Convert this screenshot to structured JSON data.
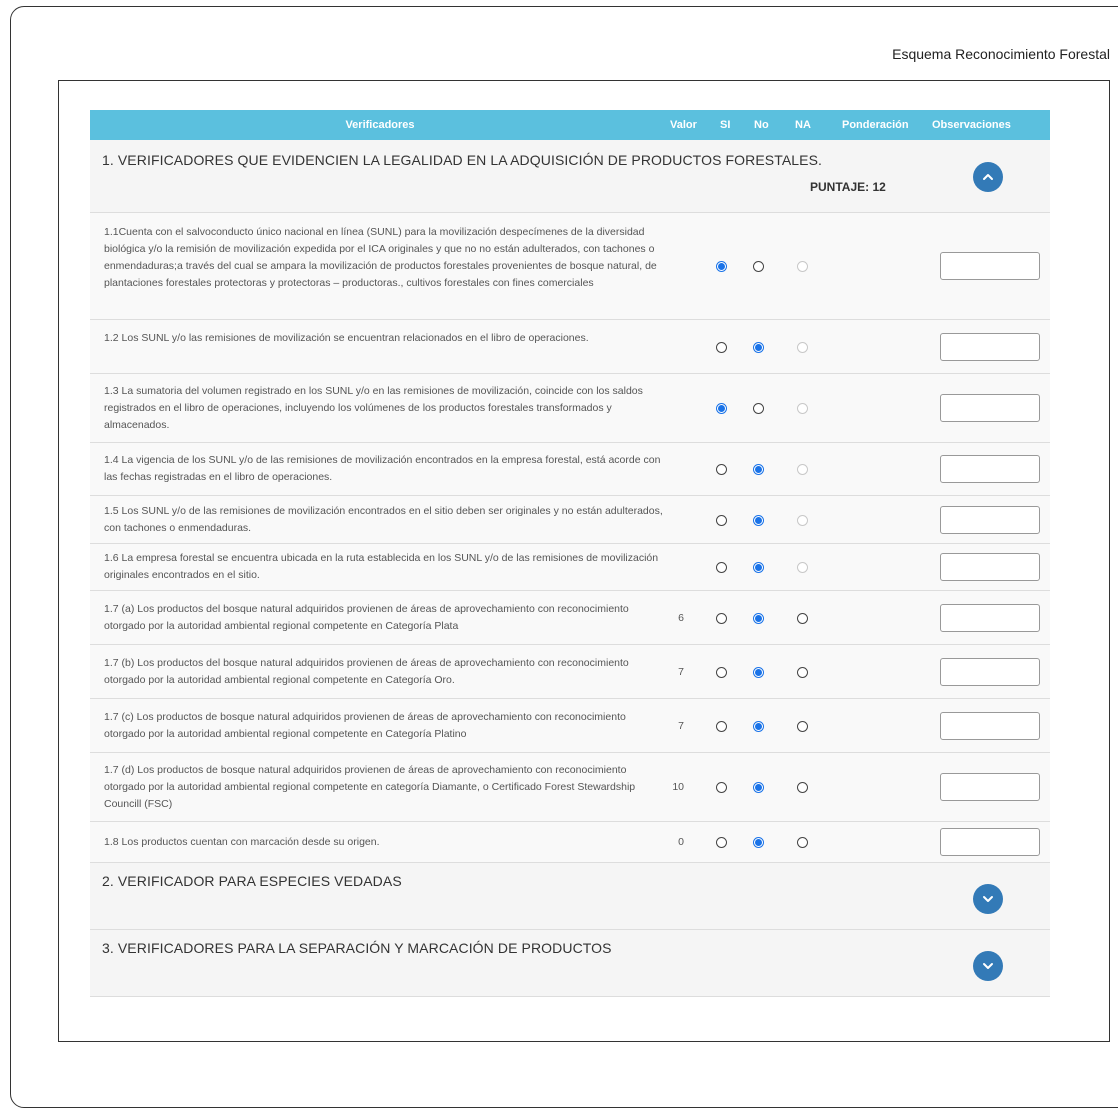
{
  "page": {
    "heading": "Esquema Reconocimiento Forestal"
  },
  "table": {
    "headers": {
      "verificadores": "Verificadores",
      "valor": "Valor",
      "si": "SI",
      "no": "No",
      "na": "NA",
      "ponderacion": "Ponderación",
      "observaciones": "Observaciones"
    }
  },
  "section1": {
    "title": "1. VERIFICADORES QUE EVIDENCIEN LA LEGALIDAD EN LA ADQUISICIÓN DE PRODUCTOS FORESTALES.",
    "score": "PUNTAJE: 12",
    "toggle_icon": "chevron-up-icon",
    "rows": [
      {
        "text": "1.1Cuenta con el salvoconducto único nacional en línea (SUNL) para la movilización despecímenes de la diversidad biológica y/o la remisión de movilización expedida por el ICA originales y que no no están adulterados, con tachones o enmendaduras;a través del cual se ampara la movilización de productos forestales provenientes de bosque natural, de plantaciones forestales protectoras y protectoras – productoras., cultivos forestales con fines comerciales",
        "valor": "",
        "selected": "si",
        "na_enabled": false,
        "observaciones": ""
      },
      {
        "text": "1.2 Los SUNL y/o las remisiones de movilización se encuentran relacionados en el libro de operaciones.",
        "valor": "",
        "selected": "no",
        "na_enabled": false,
        "observaciones": ""
      },
      {
        "text": "1.3 La sumatoria del volumen registrado en los SUNL y/o en las remisiones de movilización, coincide con los saldos registrados en el libro de operaciones, incluyendo los volúmenes de los productos forestales transformados y almacenados.",
        "valor": "",
        "selected": "si",
        "na_enabled": false,
        "observaciones": ""
      },
      {
        "text": "1.4 La vigencia de los SUNL y/o de las remisiones de movilización encontrados en la empresa forestal, está acorde con las fechas registradas en el libro de operaciones.",
        "valor": "",
        "selected": "no",
        "na_enabled": false,
        "observaciones": ""
      },
      {
        "text": "1.5 Los SUNL y/o de las remisiones de movilización encontrados en el sitio deben ser originales y no están adulterados, con tachones o enmendaduras.",
        "valor": "",
        "selected": "no",
        "na_enabled": false,
        "observaciones": ""
      },
      {
        "text": "1.6 La empresa forestal se encuentra ubicada en la ruta establecida en los SUNL y/o de las remisiones de movilización originales encontrados en el sitio.",
        "valor": "",
        "selected": "no",
        "na_enabled": false,
        "observaciones": ""
      },
      {
        "text": "1.7 (a) Los productos del bosque natural adquiridos provienen de áreas de aprovechamiento con reconocimiento otorgado por la autoridad ambiental regional competente en Categoría Plata",
        "valor": "6",
        "selected": "no",
        "na_enabled": true,
        "observaciones": ""
      },
      {
        "text": "1.7 (b) Los productos del bosque natural adquiridos provienen de áreas de aprovechamiento con reconocimiento otorgado por la autoridad ambiental regional competente en Categoría Oro.",
        "valor": "7",
        "selected": "no",
        "na_enabled": true,
        "observaciones": ""
      },
      {
        "text": "1.7 (c) Los productos de bosque natural adquiridos provienen de áreas de aprovechamiento con reconocimiento otorgado por la autoridad ambiental regional competente en Categoría Platino",
        "valor": "7",
        "selected": "no",
        "na_enabled": true,
        "observaciones": ""
      },
      {
        "text": "1.7 (d) Los productos de bosque natural adquiridos provienen de áreas de aprovechamiento con reconocimiento otorgado por la autoridad ambiental regional competente en categoría Diamante, o Certificado Forest Stewardship Councill (FSC)",
        "valor": "10",
        "selected": "no",
        "na_enabled": true,
        "observaciones": ""
      },
      {
        "text": "1.8 Los productos cuentan con marcación desde su origen.",
        "valor": "0",
        "selected": "no",
        "na_enabled": true,
        "observaciones": ""
      }
    ]
  },
  "section2": {
    "title": "2. VERIFICADOR PARA ESPECIES VEDADAS",
    "toggle_icon": "chevron-down-icon"
  },
  "section3": {
    "title": "3. VERIFICADORES PARA LA SEPARACIÓN Y MARCACIÓN DE PRODUCTOS",
    "toggle_icon": "chevron-down-icon"
  }
}
